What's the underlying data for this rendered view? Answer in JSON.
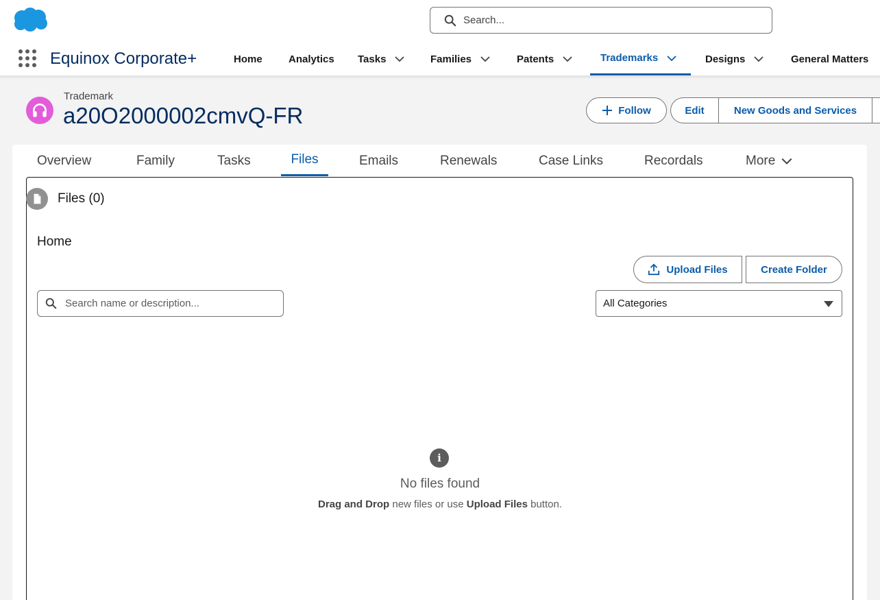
{
  "header": {
    "search_placeholder": "Search..."
  },
  "nav": {
    "app_name": "Equinox Corporate+",
    "items": [
      {
        "label": "Home"
      },
      {
        "label": "Analytics"
      },
      {
        "label": "Tasks"
      },
      {
        "label": "Families"
      },
      {
        "label": "Patents"
      },
      {
        "label": "Trademarks"
      },
      {
        "label": "Designs"
      },
      {
        "label": "General Matters"
      }
    ],
    "active": "Trademarks"
  },
  "record": {
    "type": "Trademark",
    "title": "a20O2000002cmvQ-FR",
    "follow_label": "Follow",
    "edit_label": "Edit",
    "goods_label": "New Goods and Services"
  },
  "tabs": [
    {
      "label": "Overview"
    },
    {
      "label": "Family"
    },
    {
      "label": "Tasks"
    },
    {
      "label": "Files"
    },
    {
      "label": "Emails"
    },
    {
      "label": "Renewals"
    },
    {
      "label": "Case Links"
    },
    {
      "label": "Recordals"
    },
    {
      "label": "More"
    }
  ],
  "active_tab": "Files",
  "files": {
    "title": "Files (0)",
    "folder": "Home",
    "upload_label": "Upload Files",
    "create_folder_label": "Create Folder",
    "search_placeholder": "Search name or description...",
    "category_selected": "All Categories",
    "empty_title": "No files found",
    "empty_hint": {
      "part1": "Drag and Drop",
      "part2": " new files or use ",
      "part3": "Upload Files",
      "part4": " button."
    }
  },
  "colors": {
    "brand_blue": "#0b5cab",
    "record_icon": "#e35cd9",
    "logo": "#1b96e0"
  }
}
